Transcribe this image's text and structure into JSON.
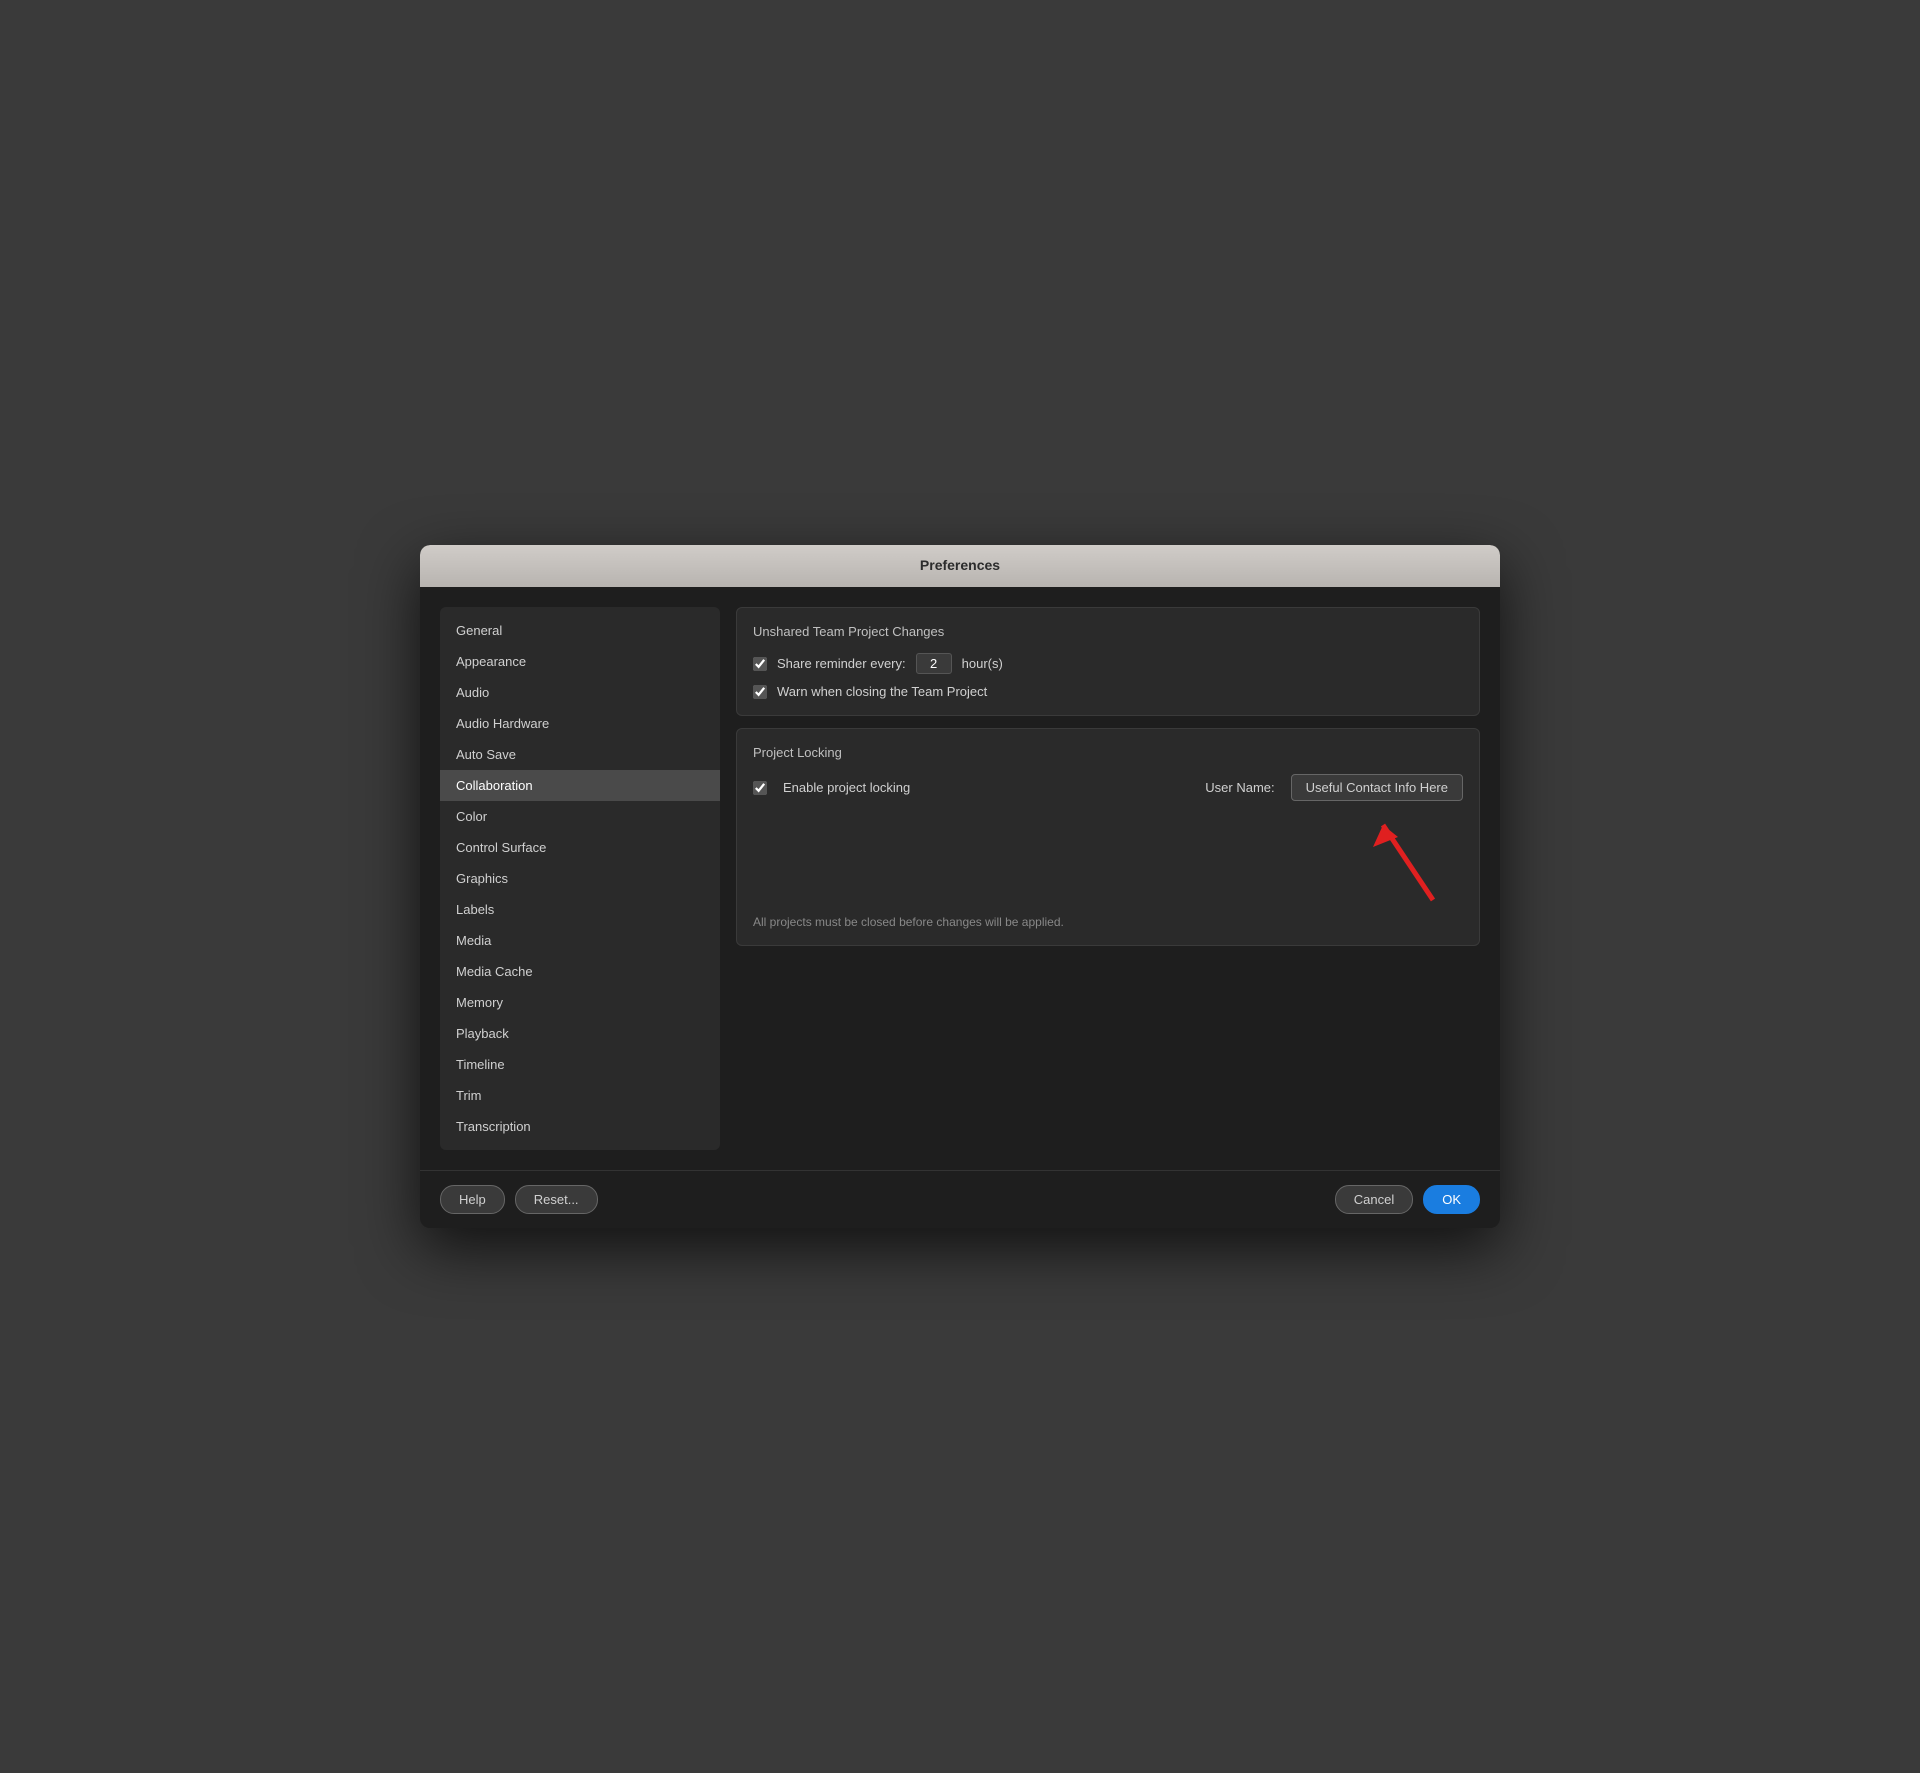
{
  "dialog": {
    "title": "Preferences"
  },
  "sidebar": {
    "items": [
      {
        "id": "general",
        "label": "General",
        "active": false
      },
      {
        "id": "appearance",
        "label": "Appearance",
        "active": false
      },
      {
        "id": "audio",
        "label": "Audio",
        "active": false
      },
      {
        "id": "audio-hardware",
        "label": "Audio Hardware",
        "active": false
      },
      {
        "id": "auto-save",
        "label": "Auto Save",
        "active": false
      },
      {
        "id": "collaboration",
        "label": "Collaboration",
        "active": true
      },
      {
        "id": "color",
        "label": "Color",
        "active": false
      },
      {
        "id": "control-surface",
        "label": "Control Surface",
        "active": false
      },
      {
        "id": "graphics",
        "label": "Graphics",
        "active": false
      },
      {
        "id": "labels",
        "label": "Labels",
        "active": false
      },
      {
        "id": "media",
        "label": "Media",
        "active": false
      },
      {
        "id": "media-cache",
        "label": "Media Cache",
        "active": false
      },
      {
        "id": "memory",
        "label": "Memory",
        "active": false
      },
      {
        "id": "playback",
        "label": "Playback",
        "active": false
      },
      {
        "id": "timeline",
        "label": "Timeline",
        "active": false
      },
      {
        "id": "trim",
        "label": "Trim",
        "active": false
      },
      {
        "id": "transcription",
        "label": "Transcription",
        "active": false
      }
    ]
  },
  "main": {
    "unshared_section": {
      "title": "Unshared Team Project Changes",
      "share_reminder_label": "Share reminder every:",
      "share_reminder_value": "2",
      "share_reminder_unit": "hour(s)",
      "warn_label": "Warn when closing the Team Project",
      "share_checked": true,
      "warn_checked": true
    },
    "project_locking_section": {
      "title": "Project Locking",
      "enable_label": "Enable project locking",
      "enable_checked": true,
      "user_name_label": "User Name:",
      "user_name_button": "Useful Contact Info Here",
      "info_text": "All projects must be closed before changes will be applied."
    }
  },
  "footer": {
    "help_label": "Help",
    "reset_label": "Reset...",
    "cancel_label": "Cancel",
    "ok_label": "OK"
  }
}
